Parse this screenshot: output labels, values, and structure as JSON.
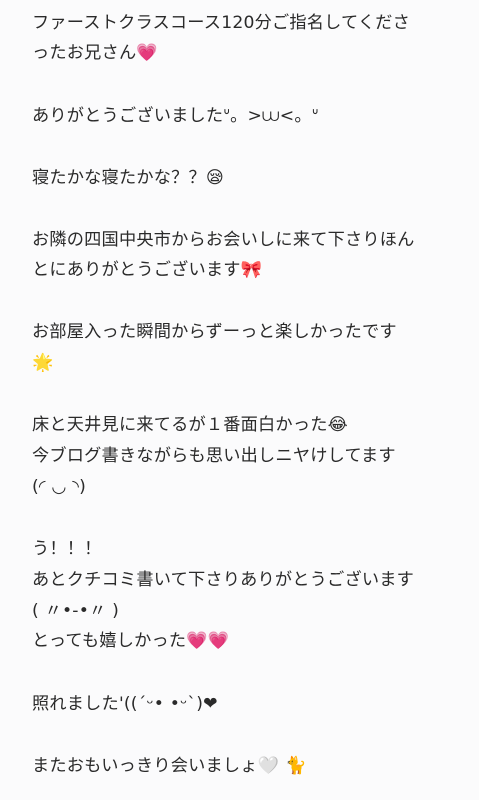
{
  "post": {
    "lines": [
      "ファーストクラスコース120分ご指名してくださ",
      "ったお兄さん💗",
      "ありがとうございましたᐡ。>⩊<。ᐡ",
      "寝たかな寝たかな？？😪",
      "お隣の四国中央市からお会いしに来て下さりほん",
      "とにありがとうございます🎀",
      "お部屋入った瞬間からずーっと楽しかったです",
      "🌟",
      "床と天井見に来てるが１番面白かった😂",
      "今ブログ書きながらも思い出しニヤけしてます",
      "(◜ ◡ ◝)",
      "う！！！",
      "あとクチコミ書いて下さりありがとうございます",
      "( 〃•-•〃 )",
      "とっても嬉しかった💗💗",
      "照れました'((ˊᵕ• •ᵕˋ)❤",
      "またおもいっきり会いましょ🤍 🐈"
    ]
  }
}
